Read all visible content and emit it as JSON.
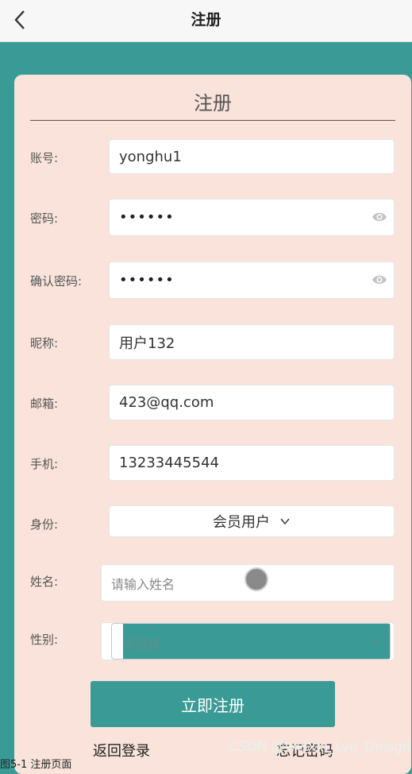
{
  "header": {
    "title": "注册",
    "back_icon": "chevron-left-icon"
  },
  "card": {
    "title": "注册"
  },
  "fields": {
    "account": {
      "label": "账号:",
      "value": "yonghu1"
    },
    "password": {
      "label": "密码:",
      "value": "••••••",
      "icon": "eye-icon"
    },
    "confirm_password": {
      "label": "确认密码:",
      "value": "••••••",
      "icon": "eye-icon"
    },
    "nickname": {
      "label": "昵称:",
      "value": "用户132"
    },
    "email": {
      "label": "邮箱:",
      "value": "423@qq.com"
    },
    "phone": {
      "label": "手机:",
      "value": "13233445544"
    },
    "role": {
      "label": "身份:",
      "value": "会员用户",
      "icon": "chevron-down-icon"
    },
    "name": {
      "label": "姓名:",
      "placeholder": "请输入姓名"
    },
    "gender": {
      "label": "性别:",
      "placeholder": "请选择",
      "icon": "chevron-down-icon"
    }
  },
  "actions": {
    "submit": "立即注册",
    "back_to_login": "返回登录",
    "forgot_password": "忘记密码"
  },
  "watermark": "CSDN @weixin_Lye_Design",
  "caption": "图5-1 注册页面",
  "colors": {
    "accent": "#3a9b96",
    "card": "#f9e3db",
    "topbar": "#f7f7f7"
  }
}
